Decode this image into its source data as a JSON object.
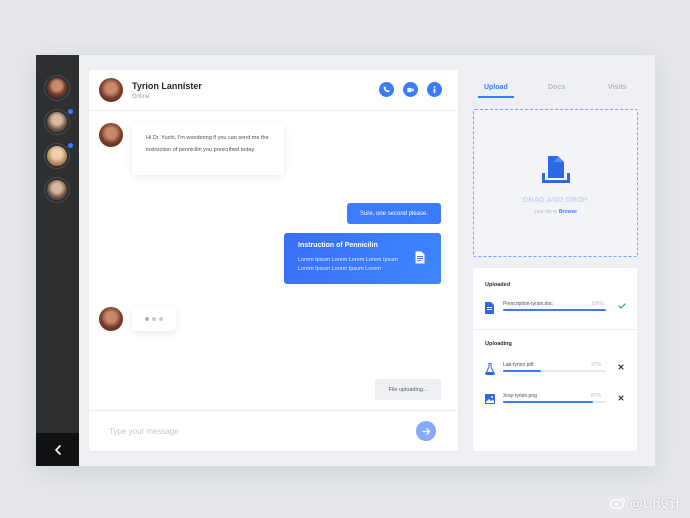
{
  "contact": {
    "name": "Tyrion Lannister",
    "status": "Online"
  },
  "messages": {
    "incoming": "Hi Dr. Yuchi, I'm wondering if you can send me the instruction of pennicilin you prescribed today",
    "outgoing": "Sure, one second please.",
    "file_title": "Instruction of Pennicilin",
    "file_desc": "Lorem Ipsum Lorem Lorem Lorem Ipsum Lorem Ipsum Lorem Ipsum Lorem",
    "uploading_status": "File uploading..."
  },
  "composer": {
    "placeholder": "Type your message"
  },
  "tabs": [
    "Upload",
    "Docs",
    "Visits"
  ],
  "dropzone": {
    "title": "DRAG AND DROP",
    "sub_prefix": "your file or",
    "sub_link": "Browse"
  },
  "uploaded": {
    "title": "Uploaded",
    "files": [
      {
        "name": "Prescription-tyrion.doc",
        "percent": "100%",
        "progress": 1.0
      }
    ]
  },
  "uploading": {
    "title": "Uploading",
    "files": [
      {
        "name": "Lab-tyrion.pdf",
        "percent": "37%",
        "progress": 0.37
      },
      {
        "name": "Xray-tyrion.png",
        "percent": "87%",
        "progress": 0.87
      }
    ]
  },
  "watermark": "@UI设计",
  "colors": {
    "accent": "#3a7bff",
    "rail": "#2d2f31",
    "success": "#3dbb7e"
  },
  "icons": [
    "phone-icon",
    "video-icon",
    "info-icon",
    "send-arrow-icon",
    "chevron-left-icon",
    "document-icon",
    "upload-icon",
    "check-icon",
    "close-icon",
    "flask-icon",
    "image-icon"
  ]
}
